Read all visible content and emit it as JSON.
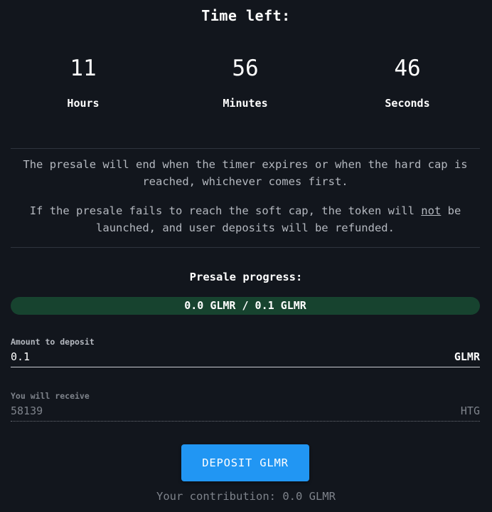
{
  "title": "Time left:",
  "timer": {
    "hours": {
      "value": "11",
      "label": "Hours"
    },
    "minutes": {
      "value": "56",
      "label": "Minutes"
    },
    "seconds": {
      "value": "46",
      "label": "Seconds"
    }
  },
  "info": {
    "paragraph1": "The presale will end when the timer expires or when the hard cap is reached, whichever comes first.",
    "paragraph2_before": "If the presale fails to reach the soft cap, the token will ",
    "paragraph2_emphasis": "not",
    "paragraph2_after": " be launched, and user deposits will be refunded."
  },
  "progress": {
    "title": "Presale progress:",
    "text": "0.0 GLMR / 0.1 GLMR",
    "fraction": 0.0
  },
  "deposit_field": {
    "label": "Amount to deposit",
    "value": "0.1",
    "suffix": "GLMR"
  },
  "receive_field": {
    "label": "You will receive",
    "value": "58139",
    "suffix": "HTG"
  },
  "deposit_button": {
    "label": "DEPOSIT GLMR"
  },
  "contribution": "Your contribution: 0.0 GLMR",
  "colors": {
    "background": "#12161d",
    "accent": "#2196f3",
    "progress_track": "#17432f"
  }
}
